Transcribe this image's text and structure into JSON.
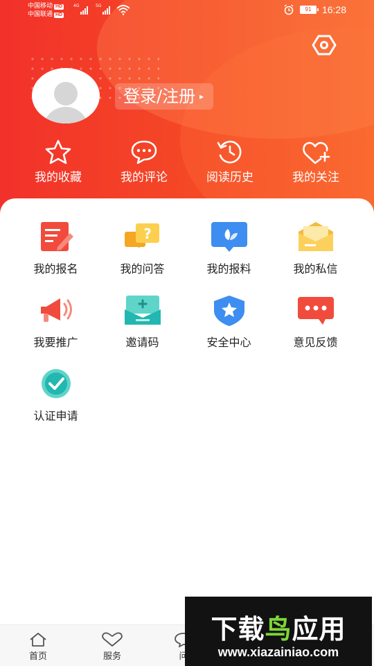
{
  "status": {
    "carrier1": "中国移动",
    "carrier2": "中国联通",
    "hd_badge": "HD",
    "net1": "4G",
    "net2": "5G",
    "battery": "91",
    "time": "16:28"
  },
  "header": {
    "login_label": "登录/注册",
    "login_arrow": "▸",
    "quick_actions": [
      {
        "label": "我的收藏",
        "icon": "star-icon"
      },
      {
        "label": "我的评论",
        "icon": "comment-icon"
      },
      {
        "label": "阅读历史",
        "icon": "history-icon"
      },
      {
        "label": "我的关注",
        "icon": "heart-plus-icon"
      }
    ]
  },
  "services": [
    {
      "label": "我的报名",
      "icon": "signup-icon"
    },
    {
      "label": "我的问答",
      "icon": "qa-icon"
    },
    {
      "label": "我的报料",
      "icon": "report-icon"
    },
    {
      "label": "我的私信",
      "icon": "mail-icon"
    },
    {
      "label": "我要推广",
      "icon": "megaphone-icon"
    },
    {
      "label": "邀请码",
      "icon": "invite-code-icon"
    },
    {
      "label": "安全中心",
      "icon": "shield-icon"
    },
    {
      "label": "意见反馈",
      "icon": "feedback-icon"
    },
    {
      "label": "认证申请",
      "icon": "certification-icon"
    }
  ],
  "bottom_nav": [
    {
      "label": "首页",
      "icon": "home-icon"
    },
    {
      "label": "服务",
      "icon": "heart-icon"
    },
    {
      "label": "问",
      "icon": "chat-icon"
    }
  ],
  "watermark": {
    "title_part1": "下载",
    "title_part2": "鸟",
    "title_part3": "应用",
    "url": "www.xiazainiao.com"
  },
  "colors": {
    "header_red": "#f2312a",
    "header_orange": "#f8652d",
    "watermark_green": "#7fd638"
  }
}
